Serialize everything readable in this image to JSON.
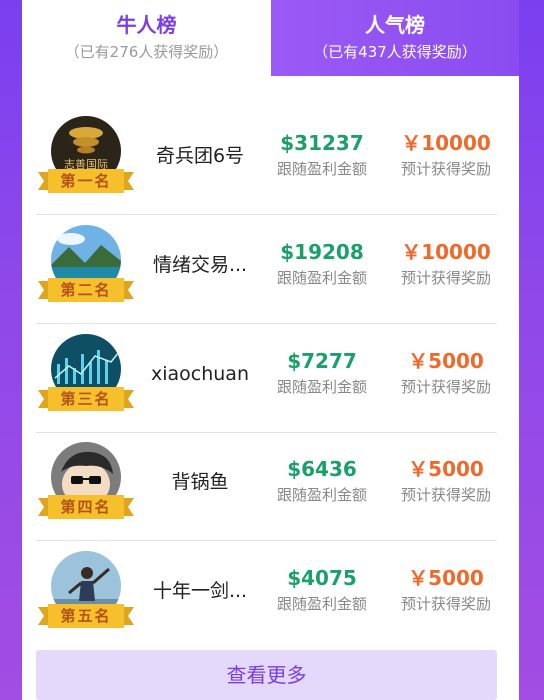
{
  "tabs": [
    {
      "title": "牛人榜",
      "subtitle": "（已有276人获得奖励）"
    },
    {
      "title": "人气榜",
      "subtitle": "（已有437人获得奖励）"
    }
  ],
  "rows": [
    {
      "rank": "第一名",
      "name": "奇兵团6号",
      "profit": "$31237",
      "profit_caption": "跟随盈利金额",
      "reward": "￥10000",
      "reward_caption": "预计获得奖励",
      "avatar_text": "志善国际"
    },
    {
      "rank": "第二名",
      "name": "情绪交易...",
      "profit": "$19208",
      "profit_caption": "跟随盈利金额",
      "reward": "￥10000",
      "reward_caption": "预计获得奖励"
    },
    {
      "rank": "第三名",
      "name": "xiaochuan",
      "profit": "$7277",
      "profit_caption": "跟随盈利金额",
      "reward": "￥5000",
      "reward_caption": "预计获得奖励"
    },
    {
      "rank": "第四名",
      "name": "背锅鱼",
      "profit": "$6436",
      "profit_caption": "跟随盈利金额",
      "reward": "￥5000",
      "reward_caption": "预计获得奖励"
    },
    {
      "rank": "第五名",
      "name": "十年一剑...",
      "profit": "$4075",
      "profit_caption": "跟随盈利金额",
      "reward": "￥5000",
      "reward_caption": "预计获得奖励"
    }
  ],
  "more_button": "查看更多",
  "colors": {
    "accent": "#7a3fe3",
    "profit": "#1aa06a",
    "reward": "#ef6a2a",
    "ribbon": "#f5c02c"
  },
  "icons": {
    "avatar": "user-avatar",
    "ribbon": "rank-ribbon"
  }
}
